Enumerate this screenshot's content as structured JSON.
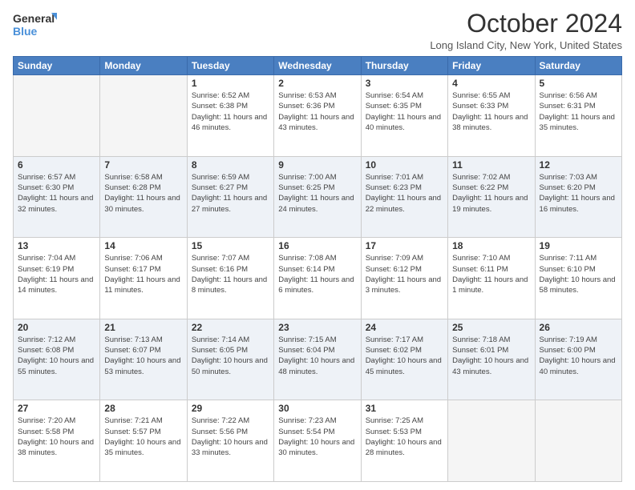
{
  "header": {
    "logo_line1": "General",
    "logo_line2": "Blue",
    "month_title": "October 2024",
    "location": "Long Island City, New York, United States"
  },
  "days_of_week": [
    "Sunday",
    "Monday",
    "Tuesday",
    "Wednesday",
    "Thursday",
    "Friday",
    "Saturday"
  ],
  "weeks": [
    [
      {
        "day": "",
        "info": ""
      },
      {
        "day": "",
        "info": ""
      },
      {
        "day": "1",
        "info": "Sunrise: 6:52 AM\nSunset: 6:38 PM\nDaylight: 11 hours and 46 minutes."
      },
      {
        "day": "2",
        "info": "Sunrise: 6:53 AM\nSunset: 6:36 PM\nDaylight: 11 hours and 43 minutes."
      },
      {
        "day": "3",
        "info": "Sunrise: 6:54 AM\nSunset: 6:35 PM\nDaylight: 11 hours and 40 minutes."
      },
      {
        "day": "4",
        "info": "Sunrise: 6:55 AM\nSunset: 6:33 PM\nDaylight: 11 hours and 38 minutes."
      },
      {
        "day": "5",
        "info": "Sunrise: 6:56 AM\nSunset: 6:31 PM\nDaylight: 11 hours and 35 minutes."
      }
    ],
    [
      {
        "day": "6",
        "info": "Sunrise: 6:57 AM\nSunset: 6:30 PM\nDaylight: 11 hours and 32 minutes."
      },
      {
        "day": "7",
        "info": "Sunrise: 6:58 AM\nSunset: 6:28 PM\nDaylight: 11 hours and 30 minutes."
      },
      {
        "day": "8",
        "info": "Sunrise: 6:59 AM\nSunset: 6:27 PM\nDaylight: 11 hours and 27 minutes."
      },
      {
        "day": "9",
        "info": "Sunrise: 7:00 AM\nSunset: 6:25 PM\nDaylight: 11 hours and 24 minutes."
      },
      {
        "day": "10",
        "info": "Sunrise: 7:01 AM\nSunset: 6:23 PM\nDaylight: 11 hours and 22 minutes."
      },
      {
        "day": "11",
        "info": "Sunrise: 7:02 AM\nSunset: 6:22 PM\nDaylight: 11 hours and 19 minutes."
      },
      {
        "day": "12",
        "info": "Sunrise: 7:03 AM\nSunset: 6:20 PM\nDaylight: 11 hours and 16 minutes."
      }
    ],
    [
      {
        "day": "13",
        "info": "Sunrise: 7:04 AM\nSunset: 6:19 PM\nDaylight: 11 hours and 14 minutes."
      },
      {
        "day": "14",
        "info": "Sunrise: 7:06 AM\nSunset: 6:17 PM\nDaylight: 11 hours and 11 minutes."
      },
      {
        "day": "15",
        "info": "Sunrise: 7:07 AM\nSunset: 6:16 PM\nDaylight: 11 hours and 8 minutes."
      },
      {
        "day": "16",
        "info": "Sunrise: 7:08 AM\nSunset: 6:14 PM\nDaylight: 11 hours and 6 minutes."
      },
      {
        "day": "17",
        "info": "Sunrise: 7:09 AM\nSunset: 6:12 PM\nDaylight: 11 hours and 3 minutes."
      },
      {
        "day": "18",
        "info": "Sunrise: 7:10 AM\nSunset: 6:11 PM\nDaylight: 11 hours and 1 minute."
      },
      {
        "day": "19",
        "info": "Sunrise: 7:11 AM\nSunset: 6:10 PM\nDaylight: 10 hours and 58 minutes."
      }
    ],
    [
      {
        "day": "20",
        "info": "Sunrise: 7:12 AM\nSunset: 6:08 PM\nDaylight: 10 hours and 55 minutes."
      },
      {
        "day": "21",
        "info": "Sunrise: 7:13 AM\nSunset: 6:07 PM\nDaylight: 10 hours and 53 minutes."
      },
      {
        "day": "22",
        "info": "Sunrise: 7:14 AM\nSunset: 6:05 PM\nDaylight: 10 hours and 50 minutes."
      },
      {
        "day": "23",
        "info": "Sunrise: 7:15 AM\nSunset: 6:04 PM\nDaylight: 10 hours and 48 minutes."
      },
      {
        "day": "24",
        "info": "Sunrise: 7:17 AM\nSunset: 6:02 PM\nDaylight: 10 hours and 45 minutes."
      },
      {
        "day": "25",
        "info": "Sunrise: 7:18 AM\nSunset: 6:01 PM\nDaylight: 10 hours and 43 minutes."
      },
      {
        "day": "26",
        "info": "Sunrise: 7:19 AM\nSunset: 6:00 PM\nDaylight: 10 hours and 40 minutes."
      }
    ],
    [
      {
        "day": "27",
        "info": "Sunrise: 7:20 AM\nSunset: 5:58 PM\nDaylight: 10 hours and 38 minutes."
      },
      {
        "day": "28",
        "info": "Sunrise: 7:21 AM\nSunset: 5:57 PM\nDaylight: 10 hours and 35 minutes."
      },
      {
        "day": "29",
        "info": "Sunrise: 7:22 AM\nSunset: 5:56 PM\nDaylight: 10 hours and 33 minutes."
      },
      {
        "day": "30",
        "info": "Sunrise: 7:23 AM\nSunset: 5:54 PM\nDaylight: 10 hours and 30 minutes."
      },
      {
        "day": "31",
        "info": "Sunrise: 7:25 AM\nSunset: 5:53 PM\nDaylight: 10 hours and 28 minutes."
      },
      {
        "day": "",
        "info": ""
      },
      {
        "day": "",
        "info": ""
      }
    ]
  ]
}
